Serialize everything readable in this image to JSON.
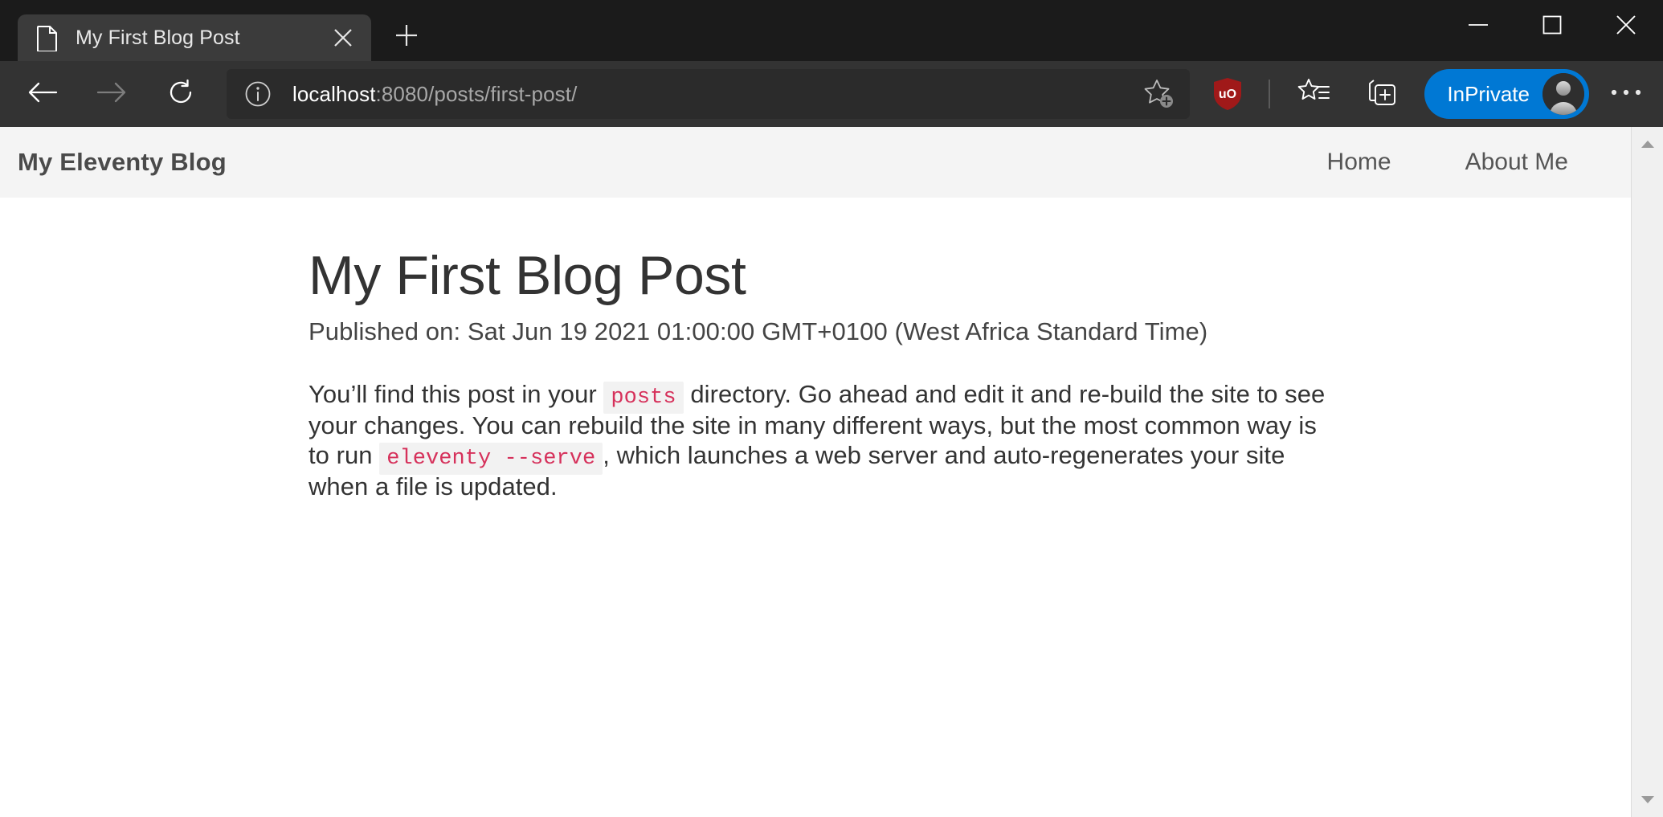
{
  "browser": {
    "tab": {
      "title": "My First Blog Post",
      "favicon_icon": "document-icon",
      "close_icon": "close-icon"
    },
    "new_tab_icon": "plus-icon",
    "window_controls": {
      "minimize_icon": "minimize-icon",
      "maximize_icon": "maximize-icon",
      "close_icon": "close-icon"
    },
    "toolbar": {
      "back_icon": "back-arrow-icon",
      "forward_icon": "forward-arrow-icon",
      "reload_icon": "reload-icon",
      "site_info_icon": "info-icon",
      "url_host": "localhost",
      "url_rest": ":8080/posts/first-post/",
      "url_full": "localhost:8080/posts/first-post/",
      "add_favorite_icon": "star-plus-icon",
      "extension_icon": "ublock-origin-icon",
      "extension_label": "uO",
      "favorites_icon": "favorites-star-list-icon",
      "collections_icon": "collections-icon",
      "inprivate_label": "InPrivate",
      "avatar_icon": "person-avatar-icon",
      "settings_more_icon": "ellipsis-icon"
    },
    "colors": {
      "titlebar_bg": "#1b1b1b",
      "toolbar_bg": "#333333",
      "tab_active_bg": "#3b3b3b",
      "omnibox_bg": "#2b2b2b",
      "inprivate_accent": "#0078d4",
      "extension_red": "#a01919"
    }
  },
  "site": {
    "header": {
      "title": "My Eleventy Blog",
      "nav": [
        {
          "label": "Home"
        },
        {
          "label": "About Me"
        }
      ]
    },
    "post": {
      "title": "My First Blog Post",
      "meta": "Published on: Sat Jun 19 2021 01:00:00 GMT+0100 (West Africa Standard Time)",
      "body": {
        "part1": "You’ll find this post in your",
        "code1": "posts",
        "part2": "directory. Go ahead and edit it and re-build the site to see your changes. You can rebuild the site in many different ways, but the most common way is to run",
        "code2": "eleventy --serve",
        "part3": ", which launches a web server and auto-regenerates your site when a file is updated."
      }
    },
    "colors": {
      "header_bg": "#f4f4f4",
      "code_text": "#d6315b",
      "code_bg": "#f2f2f2",
      "body_text": "#333333"
    }
  },
  "scrollbar": {
    "up_icon": "scroll-up-arrow-icon",
    "down_icon": "scroll-down-arrow-icon"
  }
}
